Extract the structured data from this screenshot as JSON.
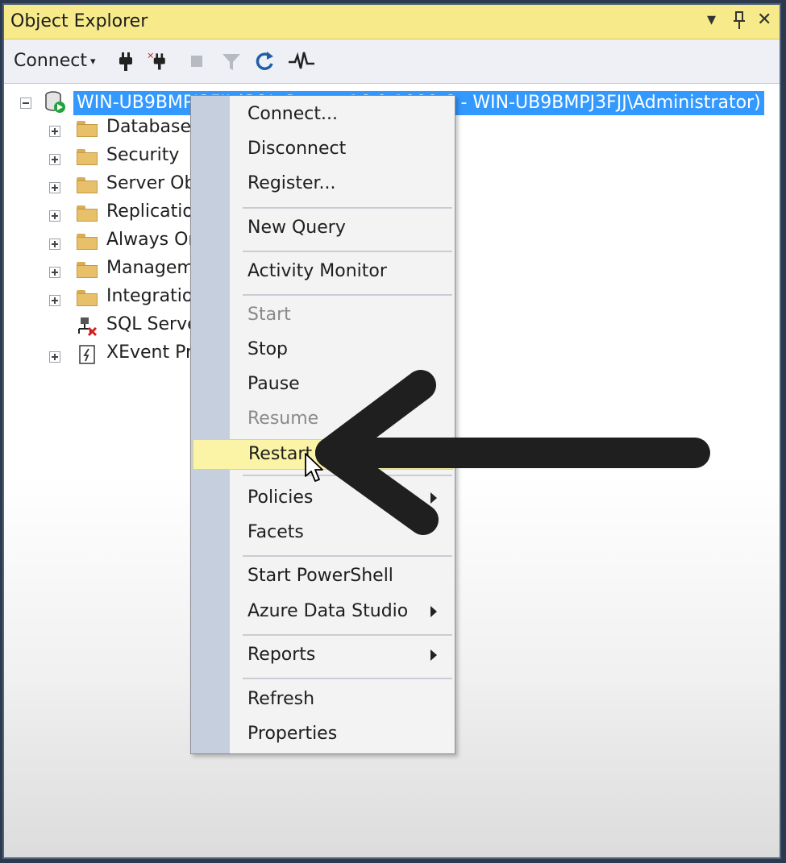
{
  "window": {
    "title": "Object Explorer",
    "controls": {
      "dropdown": "▾",
      "pin": "📌",
      "close": "✕"
    }
  },
  "toolbar": {
    "connect_label": "Connect",
    "connect_caret": "▾",
    "icons": [
      "connect-plug-icon",
      "disconnect-plug-icon",
      "stop-icon",
      "filter-icon",
      "refresh-icon",
      "activity-monitor-icon"
    ]
  },
  "tree": {
    "server_label": "WIN-UB9BMPJ3FJJ (SQL Server 16.0.1000.6 - WIN-UB9BMPJ3FJJ\\Administrator)",
    "children": [
      {
        "label": "Databases",
        "icon": "folder-icon",
        "expander": "plus"
      },
      {
        "label": "Security",
        "icon": "folder-icon",
        "expander": "plus"
      },
      {
        "label": "Server Objects",
        "icon": "folder-icon",
        "expander": "plus"
      },
      {
        "label": "Replication",
        "icon": "folder-icon",
        "expander": "plus"
      },
      {
        "label": "Always On High Availability",
        "icon": "folder-icon",
        "expander": "plus"
      },
      {
        "label": "Management",
        "icon": "folder-icon",
        "expander": "plus"
      },
      {
        "label": "Integration Services Catalogs",
        "icon": "folder-icon",
        "expander": "plus"
      },
      {
        "label": "SQL Server Agent (Agent XPs disabled)",
        "icon": "sql-agent-icon",
        "expander": "none"
      },
      {
        "label": "XEvent Profiler",
        "icon": "xevent-icon",
        "expander": "plus"
      }
    ]
  },
  "context_menu": {
    "items": [
      {
        "label": "Connect...",
        "disabled": false
      },
      {
        "label": "Disconnect",
        "disabled": false
      },
      {
        "label": "Register...",
        "disabled": false
      },
      {
        "label": "New Query",
        "disabled": false
      },
      {
        "label": "Activity Monitor",
        "disabled": false
      },
      {
        "label": "Start",
        "disabled": true
      },
      {
        "label": "Stop",
        "disabled": false
      },
      {
        "label": "Pause",
        "disabled": false
      },
      {
        "label": "Resume",
        "disabled": true
      },
      {
        "label": "Restart",
        "disabled": false,
        "highlighted": true
      },
      {
        "label": "Policies",
        "disabled": false,
        "submenu": true
      },
      {
        "label": "Facets",
        "disabled": false
      },
      {
        "label": "Start PowerShell",
        "disabled": false
      },
      {
        "label": "Azure Data Studio",
        "disabled": false,
        "submenu": true
      },
      {
        "label": "Reports",
        "disabled": false,
        "submenu": true
      },
      {
        "label": "Refresh",
        "disabled": false
      },
      {
        "label": "Properties",
        "disabled": false
      }
    ]
  },
  "colors": {
    "title_bar": "#f6ea8a",
    "selection": "#3399ff",
    "menu_hover": "#fbf3a5",
    "annotation_arrow": "#1f1f1f"
  }
}
